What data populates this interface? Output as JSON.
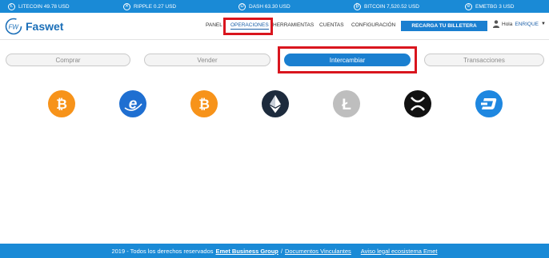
{
  "ticker": [
    {
      "icon": "litecoin-icon",
      "glyph": "Ł",
      "label": "LITECOIN 49.78 USD"
    },
    {
      "icon": "ripple-icon",
      "glyph": "✕",
      "label": "RIPPLE 0.27 USD"
    },
    {
      "icon": "dash-icon",
      "glyph": "D",
      "label": "DASH 63.30 USD"
    },
    {
      "icon": "bitcoin-icon",
      "glyph": "₿",
      "label": "BITCOIN 7,520.52 USD"
    },
    {
      "icon": "emet-icon",
      "glyph": "e",
      "label": "EMETBG 3 USD"
    }
  ],
  "header": {
    "brand": "Faswet",
    "nav": [
      "PANEL",
      "OPERACIONES",
      "HERRAMIENTAS",
      "CUENTAS",
      "CONFIGURACIÓN"
    ],
    "recharge_label": "RECARGA TU BILLETERA",
    "greeting": "Hola",
    "username": "ENRIQUE"
  },
  "tabs": [
    "Comprar",
    "Vender",
    "Intercambiar",
    "Transacciones"
  ],
  "active_tab": "Intercambiar",
  "coins": [
    "bitcoin-icon",
    "emet-icon",
    "bitcoin-cash-icon",
    "ethereum-icon",
    "litecoin-icon",
    "ripple-icon",
    "dash-icon"
  ],
  "footer": {
    "text": "2019 - Todos los derechos reservados",
    "company": "Emet Business Group",
    "separator": "/",
    "documents": "Documentos Vinculantes",
    "legal": "Aviso legal ecosistema Emet"
  },
  "colors": {
    "brand_blue": "#1a8ad6",
    "button_blue": "#1a7fd0",
    "highlight_red": "#d9151e",
    "bitcoin_orange": "#f7931a",
    "ethereum_dark": "#1d2b3d"
  }
}
